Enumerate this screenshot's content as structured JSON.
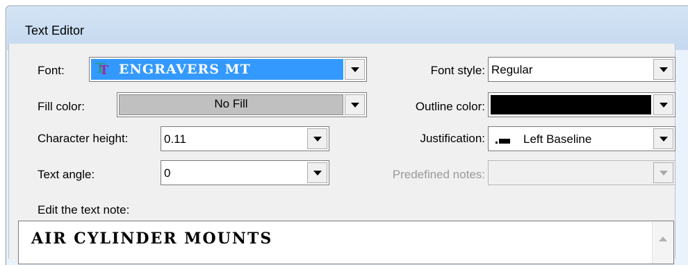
{
  "window": {
    "title": "Text Editor"
  },
  "font": {
    "label": "Font:",
    "value": "ENGRAVERS MT",
    "icon": "truetype-icon"
  },
  "font_style": {
    "label": "Font style:",
    "value": "Regular"
  },
  "fill_color": {
    "label": "Fill color:",
    "value": "No Fill"
  },
  "outline_color": {
    "label": "Outline color:",
    "color": "#000000"
  },
  "character_height": {
    "label": "Character height:",
    "value": "0.11"
  },
  "justification": {
    "label": "Justification:",
    "value": "Left Baseline"
  },
  "text_angle": {
    "label": "Text angle:",
    "value": "0"
  },
  "predefined_notes": {
    "label": "Predefined notes:",
    "value": ""
  },
  "text_note": {
    "label": "Edit the text note:",
    "value": "AIR CYLINDER MOUNTS"
  },
  "colors": {
    "selection": "#3399ff",
    "title_bar": "#c9dcf1",
    "panel": "#f0f0f0"
  }
}
